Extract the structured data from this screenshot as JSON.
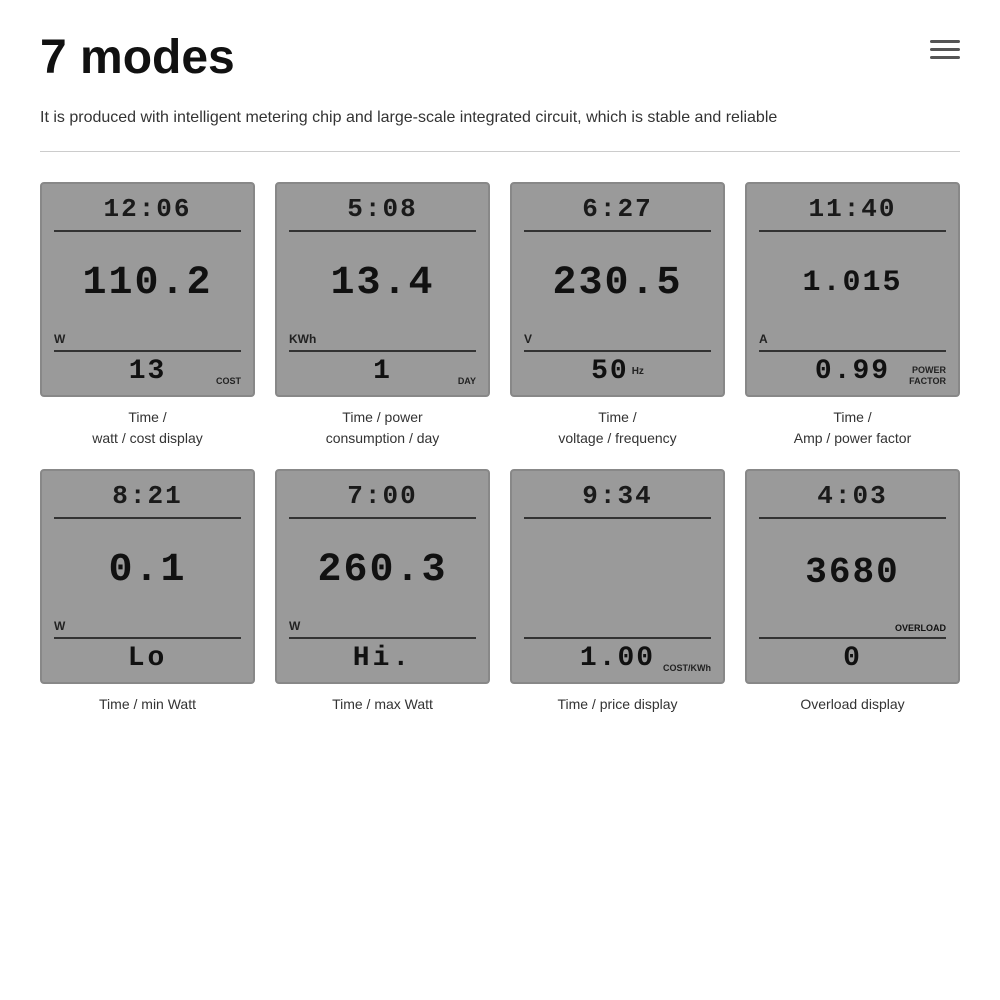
{
  "page": {
    "title": "7 modes",
    "description": "It is produced with intelligent metering chip and large-scale integrated circuit, which is stable and reliable"
  },
  "modes": [
    {
      "id": "watt-cost",
      "time": "12:06",
      "main_value": "110.2",
      "unit": "W",
      "bottom_value": "13",
      "bottom_label": "COST",
      "label_line1": "Time /",
      "label_line2": "watt / cost display"
    },
    {
      "id": "power-consumption",
      "time": "5:08",
      "main_value": "13.4",
      "unit": "KWh",
      "bottom_value": "1",
      "bottom_label": "DAY",
      "label_line1": "Time / power",
      "label_line2": "consumption / day"
    },
    {
      "id": "voltage-frequency",
      "time": "6:27",
      "main_value": "230.5",
      "unit": "V",
      "bottom_value": "50",
      "bottom_label": "Hz",
      "label_line1": "Time /",
      "label_line2": "voltage / frequency"
    },
    {
      "id": "amp-power-factor",
      "time": "11:40",
      "main_value": "1.015",
      "unit": "A",
      "bottom_value": "0.99",
      "bottom_label": "POWER\nFACTOR",
      "label_line1": "Time /",
      "label_line2": "Amp / power factor"
    },
    {
      "id": "min-watt",
      "time": "8:21",
      "main_value": "0.1",
      "unit": "W",
      "bottom_value": "Lo",
      "bottom_label": "",
      "label_line1": "Time / min Watt",
      "label_line2": ""
    },
    {
      "id": "max-watt",
      "time": "7:00",
      "main_value": "260.3",
      "unit": "W",
      "bottom_value": "Hi.",
      "bottom_label": "",
      "label_line1": "Time / max Watt",
      "label_line2": ""
    },
    {
      "id": "price-display",
      "time": "9:34",
      "main_value": "",
      "unit": "",
      "bottom_value": "1.00",
      "bottom_label": "COST/KWh",
      "label_line1": "Time / price display",
      "label_line2": ""
    },
    {
      "id": "overload",
      "time": "4:03",
      "main_value": "3680",
      "unit": "",
      "bottom_value": "0",
      "bottom_label": "OVERLOAD",
      "label_line1": "Overload display",
      "label_line2": ""
    }
  ]
}
